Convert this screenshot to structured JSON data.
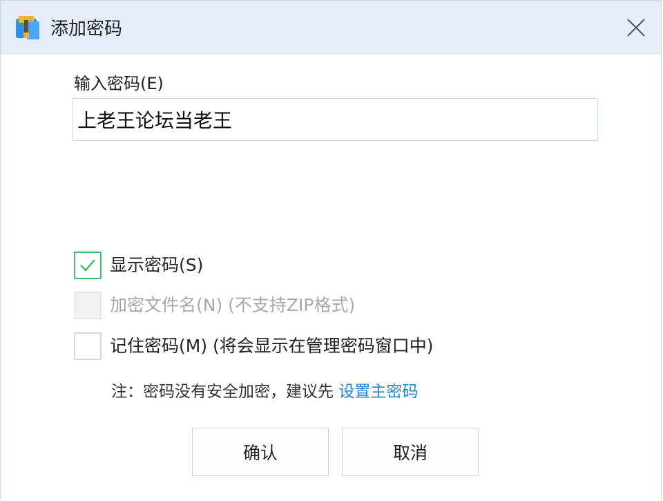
{
  "window": {
    "title": "添加密码",
    "app_icon": "archive-app-icon",
    "close_icon": "close-icon"
  },
  "password": {
    "label": "输入密码(E)",
    "value": "上老王论坛当老王"
  },
  "options": [
    {
      "label": "显示密码(S)",
      "checked": true,
      "enabled": true
    },
    {
      "label": "加密文件名(N) (不支持ZIP格式)",
      "checked": false,
      "enabled": false
    },
    {
      "label": "记住密码(M) (将会显示在管理密码窗口中)",
      "checked": false,
      "enabled": true
    }
  ],
  "note": {
    "text": "注：密码没有安全加密，建议先 ",
    "link": "设置主密码"
  },
  "buttons": {
    "ok": "确认",
    "cancel": "取消"
  },
  "colors": {
    "titlebar": "#e4edf9",
    "check_green": "#3fbf63",
    "link_blue": "#1a86d6"
  }
}
